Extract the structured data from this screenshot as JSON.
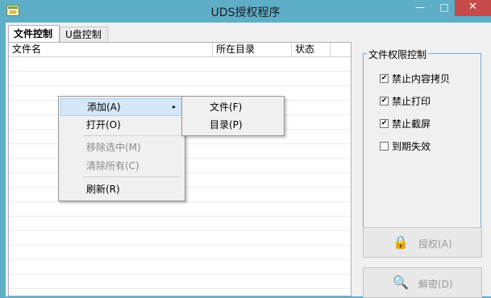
{
  "window": {
    "title": "UDS授权程序",
    "controls": {
      "minimize": "—",
      "maximize": "□",
      "close": "✕"
    }
  },
  "tabs": [
    {
      "label": "文件控制",
      "active": true
    },
    {
      "label": "U盘控制",
      "active": false
    }
  ],
  "list": {
    "columns": [
      "文件名",
      "所在目录",
      "状态"
    ],
    "rows": []
  },
  "context_menu": {
    "items": [
      {
        "label": "添加(A)",
        "enabled": true,
        "highlighted": true,
        "submenu_arrow": "▸"
      },
      {
        "label": "打开(O)",
        "enabled": true
      },
      {
        "label": "移除选中(M)",
        "enabled": false
      },
      {
        "label": "清除所有(C)",
        "enabled": false
      },
      {
        "label": "刷新(R)",
        "enabled": true
      }
    ],
    "submenu": [
      "文件(F)",
      "目录(P)"
    ]
  },
  "permissions": {
    "group_label": "文件权限控制",
    "options": [
      {
        "label": "禁止内容拷贝",
        "checked": true
      },
      {
        "label": "禁止打印",
        "checked": true
      },
      {
        "label": "禁止截屏",
        "checked": true
      },
      {
        "label": "到期失效",
        "checked": false
      }
    ],
    "check_mark": "✔"
  },
  "buttons": {
    "authorize": {
      "label": "授权(A)",
      "icon": "lock-icon",
      "glyph": "🔒",
      "enabled": false
    },
    "decrypt": {
      "label": "解密(D)",
      "icon": "key-icon",
      "glyph": "🔍",
      "enabled": false
    }
  }
}
